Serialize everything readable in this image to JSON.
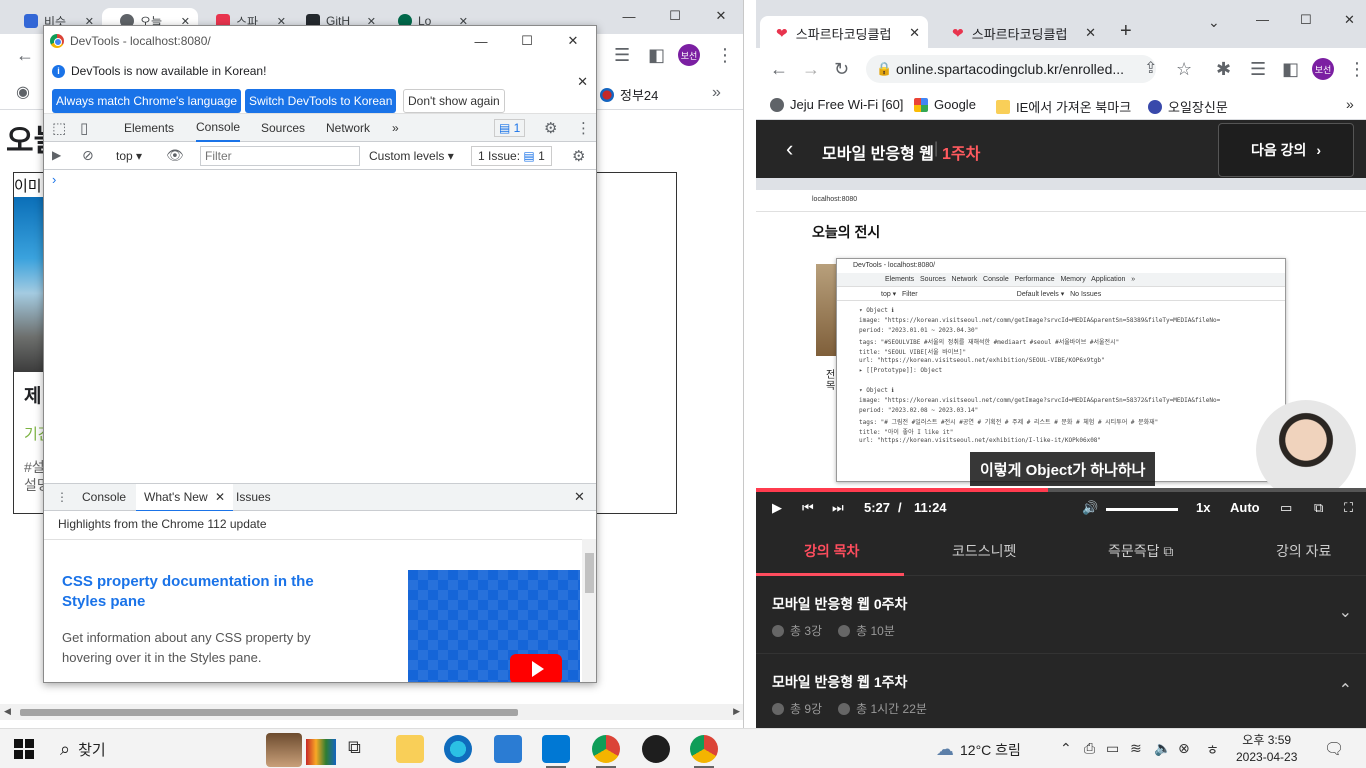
{
  "left_window": {
    "tabs": [
      {
        "label": "비슷",
        "color": "#3367d6"
      },
      {
        "label": "오늘",
        "color": "#5f6368"
      },
      {
        "label": "스파",
        "color": "#e8344e"
      },
      {
        "label": "GitH",
        "color": "#24292e"
      },
      {
        "label": "Lo",
        "color": "#00684a"
      }
    ],
    "profile": "보선",
    "bookmark_item": "정부24",
    "page_title": "오늘",
    "card": {
      "image_alt": "이미",
      "title": "제",
      "period": "기간",
      "tags": "#설",
      "desc": "설명"
    }
  },
  "devtools": {
    "window_title": "DevTools - localhost:8080/",
    "info_message": "DevTools is now available in Korean!",
    "btn_always": "Always match Chrome's language",
    "btn_switch": "Switch DevTools to Korean",
    "btn_dont_show": "Don't show again",
    "tabs": [
      "Elements",
      "Console",
      "Sources",
      "Network"
    ],
    "more_tabs": "»",
    "issues_badge": "1",
    "context": "top",
    "filter_placeholder": "Filter",
    "levels": "Custom levels",
    "issues_count": "1 Issue:",
    "issues_num": "1",
    "prompt": "›",
    "drawer_tabs": [
      "Console",
      "What's New",
      "Issues"
    ],
    "highlights": "Highlights from the Chrome 112 update",
    "feature_title": "CSS property documentation in the Styles pane",
    "feature_desc": "Get information about any CSS property by hovering over it in the Styles pane."
  },
  "right_window": {
    "tabs": [
      "스파르타코딩클럽",
      "스파르타코딩클럽"
    ],
    "url": "online.spartacodingclub.kr/enrolled...",
    "profile": "보선",
    "bookmarks": [
      "Jeju Free Wi-Fi [60]",
      "Google",
      "IE에서 가져온 북마크",
      "오일장신문"
    ],
    "lecture_title": "모바일 반응형 웹",
    "lecture_week": "1주차",
    "next_lecture": "다음 강의",
    "video": {
      "inner_url": "localhost:8080",
      "heading": "오늘의 전시",
      "dt_title": "DevTools - localhost:8080/",
      "dt_tabs": "Elements   Sources   Network   Console   Performance   Memory   Application   »",
      "dt_filter": "top ▾   Filter                                                   Default levels ▾   No Issues",
      "console_lines": [
        "▾ Object ℹ",
        "   image: \"https://korean.visitseoul.net/comm/getImage?srvcId=MEDIA&parentSn=58389&fileTy=MEDIA&fileNo=",
        "   period: \"2023.01.01 ~ 2023.04.30\"",
        "   tags: \"#SEOULVIBE #서울의 정취를 재해석한 #mediaart #seoul #서울바이브 #서울전시\"",
        "   title: \"SEOUL VIBE[서울 바이브]\"",
        "   url: \"https://korean.visitseoul.net/exhibition/SEOUL-VIBE/KOP6x9tgb\"",
        "  ▸ [[Prototype]]: Object",
        "▾ Object ℹ",
        "   image: \"https://korean.visitseoul.net/comm/getImage?srvcId=MEDIA&parentSn=58372&fileTy=MEDIA&fileNo=",
        "   period: \"2023.02.08 ~ 2023.03.14\"",
        "   tags: \"# 그림전 #일러스트 #전시 #공연 # 기획전 # 주제 # 리스트 # 문화 # 체험 # 시티투어 # 문화재\"",
        "   title: \"아이 좋아 I like it\"",
        "   url: \"https://korean.visitseoul.net/exhibition/I-like-it/KOPk06x08\""
      ],
      "subtitle": "이렇게 Object가 하나하나",
      "left_text": "전\n목"
    },
    "player": {
      "current_time": "5:27",
      "separator": "/",
      "duration": "11:24",
      "speed": "1x",
      "quality": "Auto",
      "progress_fraction": 0.479,
      "volume_fraction": 1.0
    },
    "lecture_tabs": [
      "강의 목차",
      "코드스니펫",
      "즉문즉답",
      "강의 자료"
    ],
    "weeks": [
      {
        "title": "모바일 반응형 웹 0주차",
        "lessons": "총 3강",
        "duration": "총 10분",
        "expanded": false
      },
      {
        "title": "모바일 반응형 웹 1주차",
        "lessons": "총 9강",
        "duration": "총 1시간 22분",
        "expanded": true
      }
    ]
  },
  "taskbar": {
    "search_label": "찾기",
    "weather": "12°C 흐림",
    "time": "오후 3:59",
    "date": "2023-04-23"
  },
  "colors": {
    "accent": "#1a73e8",
    "brand_red": "#ff4d5e",
    "dark_bg": "#262626"
  }
}
